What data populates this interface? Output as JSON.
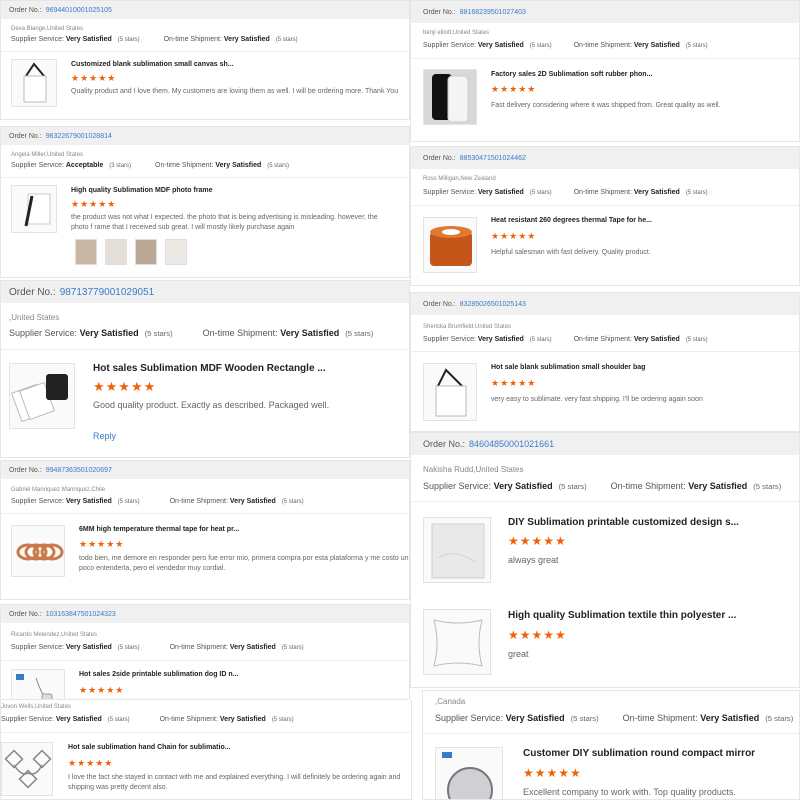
{
  "order_label": "Order No.:",
  "supplier_label": "Supplier Service:",
  "shipment_label": "On-time Shipment:",
  "stars_glyph": "★★★★★",
  "reply_label": "Reply",
  "cards": [
    {
      "order_no": "96944010001025105",
      "buyer": "Deva Blange,United States",
      "supplier_rating": "Very Satisfied",
      "supplier_stars": "(5 stars)",
      "shipment_rating": "Very Satisfied",
      "shipment_stars": "(5 stars)",
      "product": "Customized blank sublimation small canvas sh...",
      "review": "Quality product and I love them. My customers are loving them as well. I will be ordering more. Thank You",
      "thumb_icon": "tote-bag-icon"
    },
    {
      "order_no": "96322679001028814",
      "buyer": "Angela Miller,United States",
      "supplier_rating": "Acceptable",
      "supplier_stars": "(3 stars)",
      "shipment_rating": "Very Satisfied",
      "shipment_stars": "(5 stars)",
      "product": "High quality Sublimation MDF photo frame",
      "review": "the product was not what I expected. the photo that is being advertising is misleading. however, the photo f rame that I received sub great. I will mostly likely purchase again",
      "thumb_icon": "photo-frame-icon"
    },
    {
      "order_no": "98713779001029051",
      "buyer": ",United States",
      "supplier_rating": "Very Satisfied",
      "supplier_stars": "(5 stars)",
      "shipment_rating": "Very Satisfied",
      "shipment_stars": "(5 stars)",
      "product": "Hot sales Sublimation MDF Wooden Rectangle ...",
      "review": "Good quality product. Exactly as described. Packaged well.",
      "thumb_icon": "wooden-tiles-icon"
    },
    {
      "order_no": "99487363501020697",
      "buyer": "Gabriel Manriquez Manriquez,Chile",
      "supplier_rating": "Very Satisfied",
      "supplier_stars": "(5 stars)",
      "shipment_rating": "Very Satisfied",
      "shipment_stars": "(5 stars)",
      "product": "6MM high temperature thermal tape for heat pr...",
      "review": "todo bien, me demore en responder pero fue error mio, primera compra por esta plataforma y me costo un poco entenderla, pero el vendedor muy cordial.",
      "thumb_icon": "tape-rolls-icon"
    },
    {
      "order_no": "103163847501024323",
      "buyer": "Ricardo Melendez,United States",
      "supplier_rating": "Very Satisfied",
      "supplier_stars": "(5 stars)",
      "shipment_rating": "Very Satisfied",
      "shipment_stars": "(5 stars)",
      "product": "Hot sales 2side printable sublimation dog ID n...",
      "thumb_icon": "dog-tag-icon"
    },
    {
      "buyer": "Jovon Wells,United States",
      "supplier_rating": "Very Satisfied",
      "supplier_stars": "(5 stars)",
      "shipment_rating": "Very Satisfied",
      "shipment_stars": "(5 stars)",
      "product": "Hot sale sublimation hand Chain for sublimatio...",
      "review": "I love the fact she stayed in contact with me and explained everything. I will definitely be ordering again and shipping was pretty decent also.",
      "thumb_icon": "hand-chain-icon"
    },
    {
      "order_no": "88168239501027403",
      "buyer": "benji elliott,United States",
      "supplier_rating": "Very Satisfied",
      "supplier_stars": "(5 stars)",
      "shipment_rating": "Very Satisfied",
      "shipment_stars": "(5 stars)",
      "product": "Factory sales 2D Sublimation soft rubber phon...",
      "review": "Fast delivery considering where it was shipped from. Great quality as well.",
      "thumb_icon": "phone-case-icon"
    },
    {
      "order_no": "88530471501024462",
      "buyer": "Ross Milligan,New Zealand",
      "supplier_rating": "Very Satisfied",
      "supplier_stars": "(5 stars)",
      "shipment_rating": "Very Satisfied",
      "shipment_stars": "(5 stars)",
      "product": "Heat resistant 260 degrees thermal Tape for he...",
      "review": "Helpful salesman with fast delivery. Quality product.",
      "thumb_icon": "tape-roll-icon"
    },
    {
      "order_no": "83285026501025143",
      "buyer": "Shericka Brumfield,United States",
      "supplier_rating": "Very Satisfied",
      "supplier_stars": "(5 stars)",
      "shipment_rating": "Very Satisfied",
      "shipment_stars": "(5 stars)",
      "product": "Hot sale blank sublimation small shoulder bag",
      "review": "very easy to sublimate. very fast shipping. I'll be ordering again soon",
      "thumb_icon": "shoulder-bag-icon"
    },
    {
      "order_no": "84604850001021661",
      "buyer": "Nakisha Rudd,United States",
      "supplier_rating": "Very Satisfied",
      "supplier_stars": "(5 stars)",
      "shipment_rating": "Very Satisfied",
      "shipment_stars": "(5 stars)",
      "product": "DIY Sublimation printable customized design s...",
      "review": "always great",
      "product2": "High quality Sublimation textile thin polyester ...",
      "review2": "great",
      "thumb_icon": "cloth-icon",
      "thumb_icon2": "pillow-icon"
    },
    {
      "buyer": ",Canada",
      "supplier_rating": "Very Satisfied",
      "supplier_stars": "(5 stars)",
      "shipment_rating": "Very Satisfied",
      "shipment_stars": "(5 stars)",
      "product": "Customer DIY sublimation round compact mirror",
      "review": "Excellent company to work with.  Top quality products.",
      "thumb_icon": "compact-mirror-icon"
    }
  ]
}
